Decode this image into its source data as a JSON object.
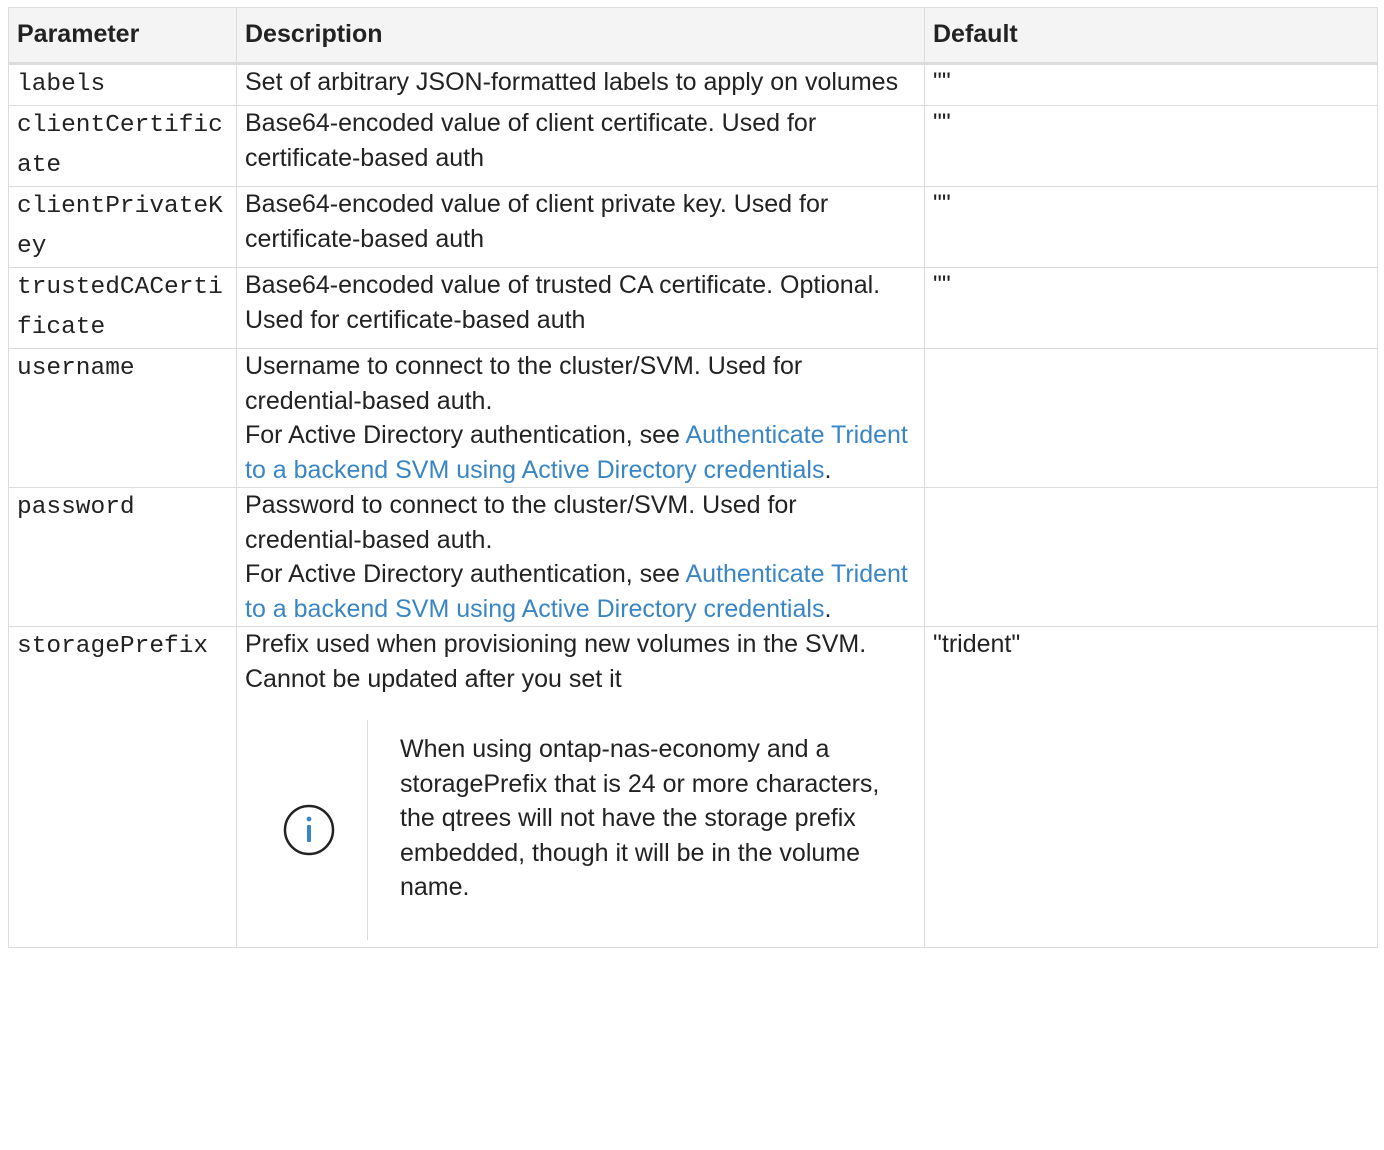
{
  "table": {
    "headers": [
      "Parameter",
      "Description",
      "Default"
    ],
    "rows": [
      {
        "param": "labels",
        "desc_lines": [
          "Set of arbitrary JSON-formatted labels to apply on volumes"
        ],
        "default": "\"\""
      },
      {
        "param": "clientCertificate",
        "desc_lines": [
          "Base64-encoded value of client certificate. Used for certificate-based auth"
        ],
        "default": "\"\""
      },
      {
        "param": "clientPrivateKey",
        "desc_lines": [
          "Base64-encoded value of client private key. Used for certificate-based auth"
        ],
        "default": "\"\""
      },
      {
        "param": "trustedCACertificate",
        "desc_lines": [
          "Base64-encoded value of trusted CA certificate. Optional. Used for certificate-based auth"
        ],
        "default": "\"\""
      },
      {
        "param": "username",
        "desc_lines": [
          "Username to connect to the cluster/SVM. Used for credential-based auth."
        ],
        "desc_ad_prefix": "For Active Directory authentication, see ",
        "desc_ad_link": "Authenticate Trident to a backend SVM using Active Directory credentials",
        "desc_ad_suffix": ".",
        "default": ""
      },
      {
        "param": "password",
        "desc_lines": [
          "Password to connect to the cluster/SVM. Used for credential-based auth."
        ],
        "desc_ad_prefix": "For Active Directory authentication, see ",
        "desc_ad_link": "Authenticate Trident to a backend SVM using Active Directory credentials",
        "desc_ad_suffix": ".",
        "default": ""
      },
      {
        "param": "storagePrefix",
        "desc_lines": [
          "Prefix used when provisioning new volumes in the SVM. Cannot be updated after you set it"
        ],
        "note": "When using ontap-nas-economy and a storagePrefix that is 24 or more characters, the qtrees will not have the storage prefix embedded, though it will be in the volume name.",
        "note_icon": "info-icon",
        "default": "\"trident\""
      }
    ]
  },
  "colors": {
    "link": "#3a86c4",
    "header_bg": "#f4f4f4",
    "border": "#dcdcdc",
    "text": "#222222"
  }
}
